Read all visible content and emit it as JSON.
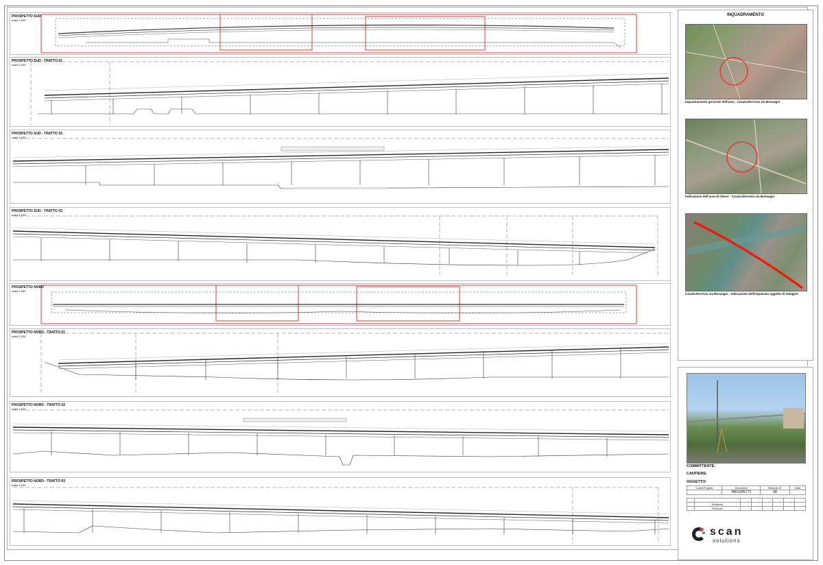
{
  "panels": [
    {
      "title": "PROSPETTO SUD",
      "scale": "scala 1:500",
      "kind": "overview"
    },
    {
      "title": "PROSPETTO SUD - TRATTO 01",
      "scale": "scala 1:200",
      "kind": "detail"
    },
    {
      "title": "PROSPETTO SUD - TRATTO 02",
      "scale": "scala 1:200",
      "kind": "detail"
    },
    {
      "title": "PROSPETTO SUD - TRATTO 03",
      "scale": "scala 1:200",
      "kind": "detail"
    },
    {
      "title": "PROSPETTO NORD",
      "scale": "scala 1:500",
      "kind": "overview"
    },
    {
      "title": "PROSPETTO NORD - TRATTO 01",
      "scale": "scala 1:200",
      "kind": "detail"
    },
    {
      "title": "PROSPETTO NORD - TRATTO 02",
      "scale": "scala 1:200",
      "kind": "detail"
    },
    {
      "title": "PROSPETTO NORD - TRATTO 03",
      "scale": "scala 1:200",
      "kind": "detail"
    }
  ],
  "sidebar": {
    "heading": "INQUADRAMENTO",
    "captions": [
      "Inquadramento generale dell'area - Cavalcaferrovia via Bonzagni",
      "Indicazione dell'area di rilievo - Cavalcaferrovia via Bonzagni",
      "Cavalcaferrovia via Bonzagni - Indicazione dell'impalcato oggetto di indagine"
    ],
    "labels": {
      "committente": "COMMITTENTE:",
      "cantiere": "CANTIERE:",
      "oggetto": "OGGETTO:"
    },
    "table": {
      "h1": "Codice Progetto",
      "h2": "Descrizione",
      "h3": "Elaborato N°",
      "h4": "Scala",
      "desc": "PROSPETTI",
      "num": "08",
      "r1": "Emissione",
      "r2": "Revisione"
    },
    "logo": {
      "name": "scan",
      "sub": "solutions"
    },
    "colors": {
      "highlight": "#e53935",
      "track": "#e8210f"
    }
  }
}
